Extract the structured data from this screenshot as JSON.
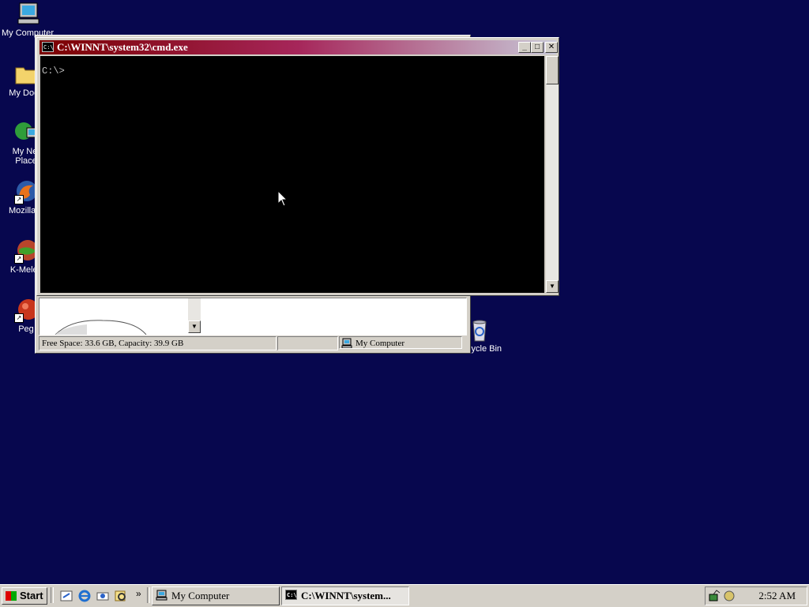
{
  "desktop": {
    "icons": [
      {
        "label": "My Computer",
        "icon": "my-computer-icon"
      },
      {
        "label": "My Docu",
        "icon": "my-documents-icon"
      },
      {
        "label": "My Net",
        "label2": "Place",
        "icon": "network-places-icon"
      },
      {
        "label": "Mozilla F",
        "icon": "firefox-icon"
      },
      {
        "label": "K-Melec",
        "icon": "k-meleon-icon"
      },
      {
        "label": "Peg",
        "icon": "pegasus-icon"
      },
      {
        "label": "Recycle Bin",
        "icon": "recycle-bin-icon"
      }
    ]
  },
  "my_computer_window": {
    "status_free": "Free Space: 33.6 GB, Capacity: 39.9 GB",
    "status_location": "My Computer"
  },
  "cmd_window": {
    "title": "C:\\WINNT\\system32\\cmd.exe",
    "prompt": "C:\\>"
  },
  "taskbar": {
    "start_label": "Start",
    "buttons": [
      {
        "label": "My Computer",
        "icon": "my-computer-icon"
      },
      {
        "label": "C:\\WINNT\\system...",
        "icon": "cmd-icon"
      }
    ],
    "quick_launch_more": "»",
    "clock": "2:52 AM"
  },
  "colors": {
    "desktop": "#07074e",
    "title_active_start": "#7b0000",
    "title_active_end": "#c8c8d8",
    "chrome": "#d4d0c8"
  }
}
